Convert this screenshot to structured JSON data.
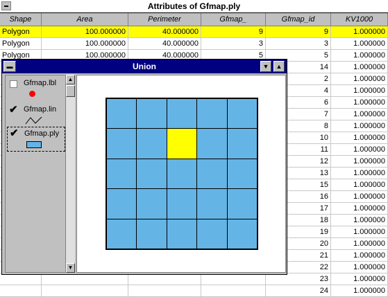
{
  "window": {
    "title": "Attributes of Gfmap.ply"
  },
  "table": {
    "columns": [
      "Shape",
      "Area",
      "Perimeter",
      "Gfmap_",
      "Gfmap_id",
      "KV1000"
    ],
    "rows": [
      [
        "Polygon",
        "100.000000",
        "40.000000",
        "9",
        "9",
        "1.000000"
      ],
      [
        "Polygon",
        "100.000000",
        "40.000000",
        "3",
        "3",
        "1.000000"
      ],
      [
        "Polygon",
        "100.000000",
        "40.000000",
        "5",
        "5",
        "1.000000"
      ],
      [
        "",
        "",
        "",
        "",
        "14",
        "1.000000"
      ],
      [
        "",
        "",
        "",
        "",
        "2",
        "1.000000"
      ],
      [
        "",
        "",
        "",
        "",
        "4",
        "1.000000"
      ],
      [
        "",
        "",
        "",
        "",
        "6",
        "1.000000"
      ],
      [
        "",
        "",
        "",
        "",
        "7",
        "1.000000"
      ],
      [
        "",
        "",
        "",
        "",
        "8",
        "1.000000"
      ],
      [
        "",
        "",
        "",
        "",
        "10",
        "1.000000"
      ],
      [
        "",
        "",
        "",
        "",
        "11",
        "1.000000"
      ],
      [
        "",
        "",
        "",
        "",
        "12",
        "1.000000"
      ],
      [
        "",
        "",
        "",
        "",
        "13",
        "1.000000"
      ],
      [
        "",
        "",
        "",
        "",
        "15",
        "1.000000"
      ],
      [
        "",
        "",
        "",
        "",
        "16",
        "1.000000"
      ],
      [
        "",
        "",
        "",
        "",
        "17",
        "1.000000"
      ],
      [
        "",
        "",
        "",
        "",
        "18",
        "1.000000"
      ],
      [
        "",
        "",
        "",
        "",
        "19",
        "1.000000"
      ],
      [
        "",
        "",
        "",
        "",
        "20",
        "1.000000"
      ],
      [
        "",
        "",
        "",
        "",
        "21",
        "1.000000"
      ],
      [
        "",
        "",
        "",
        "",
        "22",
        "1.000000"
      ],
      [
        "",
        "",
        "",
        "",
        "23",
        "1.000000"
      ],
      [
        "",
        "",
        "",
        "",
        "24",
        "1.000000"
      ]
    ],
    "selected_row": 0
  },
  "union": {
    "title": "Union",
    "legend": [
      {
        "label": "Gfmap.lbl",
        "checked": false,
        "symbol": "red-dot"
      },
      {
        "label": "Gfmap.lin",
        "checked": true,
        "symbol": "line"
      },
      {
        "label": "Gfmap.ply",
        "checked": true,
        "symbol": "blue-box"
      }
    ],
    "grid": {
      "rows": 5,
      "cols": 5,
      "selected_cell": [
        1,
        2
      ]
    },
    "colors": {
      "fill": "#64b4e6",
      "selected": "#ffff00",
      "titlebar": "#000080"
    }
  }
}
